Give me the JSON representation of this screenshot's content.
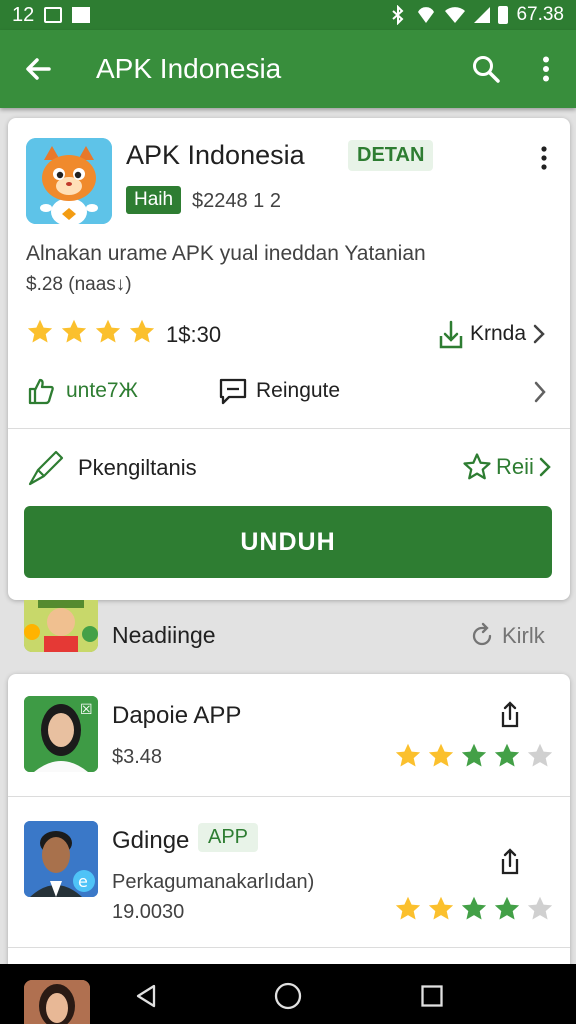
{
  "status_bar": {
    "time": "12",
    "battery_text": "67.38"
  },
  "app_bar": {
    "title": "APK Indonesia"
  },
  "main_card": {
    "app_name": "APK Indonesia",
    "badge": "DETAN",
    "tag": "Haih",
    "meta": "$2248  1  2",
    "description": "Alnakan urame APK yual ineddan Yatanian",
    "size": "$.28 (naas↓)",
    "rating": "1$:30",
    "rating_stars": 4,
    "install_label": "Krnda",
    "like_label": "unte7Ж",
    "report_label": "Reingute",
    "permissions_label": "Pkengiltanis",
    "review_label": "Reii",
    "download_button": "UNDUH"
  },
  "peek_row": {
    "name": "Neadiinge",
    "action": "Kirlk"
  },
  "list": [
    {
      "title": "Dapoie APP",
      "badge": "",
      "subtitle": "$3.48",
      "extra": "",
      "rating": 4
    },
    {
      "title": "Gdinge",
      "badge": "APP",
      "subtitle": "Perkagumanakarlıdan)",
      "extra": "19.0030",
      "rating": 4
    }
  ],
  "colors": {
    "primary": "#2e7d32",
    "app_bar": "#388e3c",
    "star": "#fbc02d",
    "star_green": "#43a047",
    "star_empty": "#d0d0d0"
  }
}
